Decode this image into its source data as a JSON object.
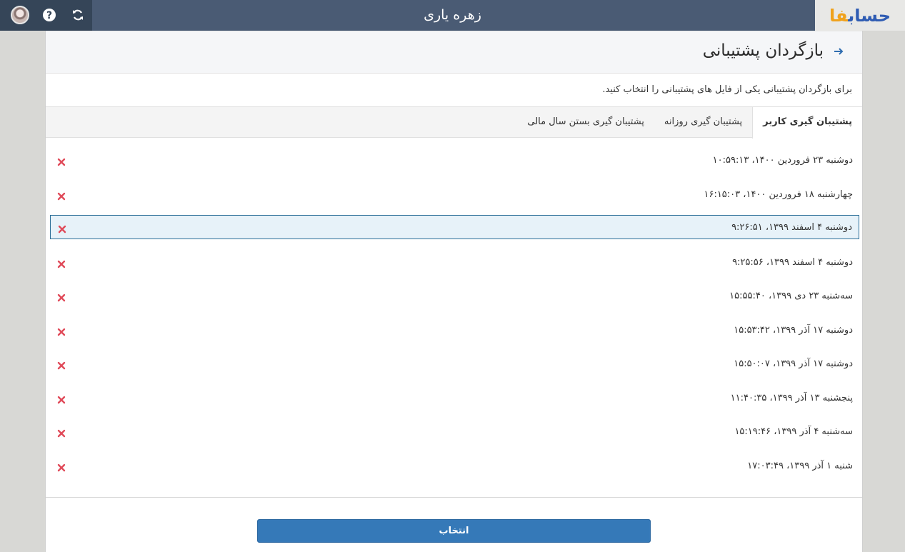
{
  "app": {
    "logo_text": "حساب",
    "logo_accent": "فا",
    "user_name": "زهره یاری"
  },
  "page": {
    "title": "بازگردان پشتیبانی",
    "instruction": "برای بازگردان پشتیبانی یکی از فایل های پشتیبانی را انتخاب کنید."
  },
  "tabs": [
    {
      "label": "پشتیبان گیری کاربر",
      "active": true
    },
    {
      "label": "پشتیبان گیری روزانه",
      "active": false
    },
    {
      "label": "پشتیبان گیری بستن سال مالی",
      "active": false
    }
  ],
  "backups": [
    {
      "label": "دوشنبه ۲۳ فروردین ۱۴۰۰، ۱۰:۵۹:۱۳",
      "selected": false
    },
    {
      "label": "چهارشنبه ۱۸ فروردین ۱۴۰۰، ۱۶:۱۵:۰۳",
      "selected": false
    },
    {
      "label": "دوشنبه ۴ اسفند ۱۳۹۹، ۹:۲۶:۵۱",
      "selected": true
    },
    {
      "label": "دوشنبه ۴ اسفند ۱۳۹۹، ۹:۲۵:۵۶",
      "selected": false
    },
    {
      "label": "سه‌شنبه ۲۳ دی ۱۳۹۹، ۱۵:۵۵:۴۰",
      "selected": false
    },
    {
      "label": "دوشنبه ۱۷ آذر ۱۳۹۹، ۱۵:۵۳:۴۲",
      "selected": false
    },
    {
      "label": "دوشنبه ۱۷ آذر ۱۳۹۹، ۱۵:۵۰:۰۷",
      "selected": false
    },
    {
      "label": "پنجشنبه ۱۳ آذر ۱۳۹۹، ۱۱:۴۰:۳۵",
      "selected": false
    },
    {
      "label": "سه‌شنبه ۴ آذر ۱۳۹۹، ۱۵:۱۹:۴۶",
      "selected": false
    },
    {
      "label": "شنبه ۱ آذر ۱۳۹۹، ۱۷:۰۳:۴۹",
      "selected": false
    }
  ],
  "actions": {
    "select_label": "انتخاب"
  },
  "icons": {
    "delete": "close-icon",
    "back": "arrow-right-icon",
    "help": "help-icon",
    "refresh": "refresh-icon",
    "avatar": "avatar"
  },
  "colors": {
    "topbar": "#4a5b74",
    "topbar_tools": "#354558",
    "accent": "#3579b8",
    "delete": "#e04a59",
    "selected_row": "#e7f2f9",
    "logo_blue": "#2f5cb3",
    "logo_orange": "#f0a21c"
  }
}
